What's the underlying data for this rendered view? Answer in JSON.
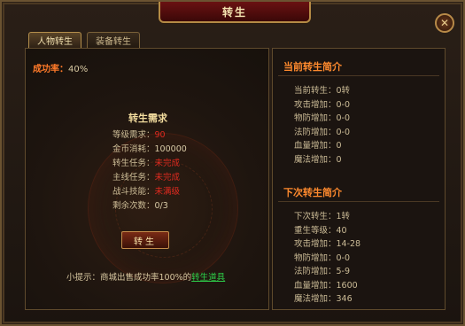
{
  "window": {
    "title": "转生",
    "close_symbol": "✕"
  },
  "tabs": [
    {
      "label": "人物转生",
      "active": true
    },
    {
      "label": "装备转生",
      "active": false
    }
  ],
  "left": {
    "success_label": "成功率：",
    "success_value": "40%",
    "req_title": "转生需求",
    "requirements": [
      {
        "key": "等级需求：",
        "value": "90",
        "status": "red"
      },
      {
        "key": "金币消耗：",
        "value": "100000",
        "status": "normal"
      },
      {
        "key": "转生任务：",
        "value": "未完成",
        "status": "red"
      },
      {
        "key": "主线任务：",
        "value": "未完成",
        "status": "red"
      },
      {
        "key": "战斗技能：",
        "value": "未满级",
        "status": "red"
      },
      {
        "key": "剩余次数：",
        "value": "0/3",
        "status": "normal"
      }
    ],
    "button_label": "转生",
    "tip_prefix": "小提示：商城出售成功率100%的",
    "tip_link": "转生道具"
  },
  "right": {
    "current_title": "当前转生简介",
    "current_stats": [
      "当前转生：0转",
      "攻击增加：0-0",
      "物防增加：0-0",
      "法防增加：0-0",
      "血量增加：0",
      "魔法增加：0"
    ],
    "next_title": "下次转生简介",
    "next_stats": [
      "下次转生：1转",
      "重生等级：40",
      "攻击增加：14-28",
      "物防增加：0-0",
      "法防增加：5-9",
      "血量增加：1600",
      "魔法增加：346"
    ]
  },
  "colors": {
    "accent_orange": "#ff7a29",
    "requirement_red": "#e02a1f",
    "link_green": "#2ed04a"
  }
}
